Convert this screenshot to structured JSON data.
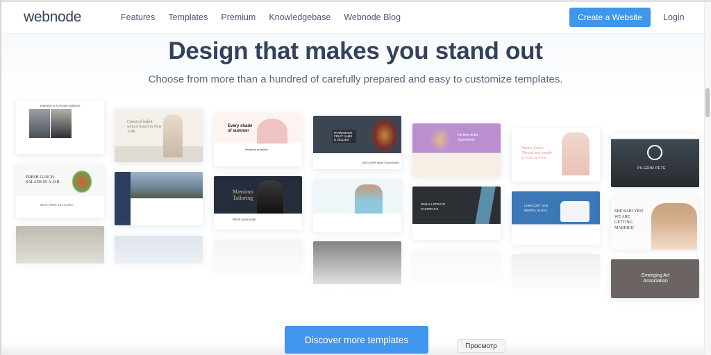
{
  "nav": {
    "logo": "webnode",
    "links": [
      "Features",
      "Templates",
      "Premium",
      "Knowledgebase",
      "Webnode Blog"
    ],
    "cta": "Create a Website",
    "login": "Login"
  },
  "hero": {
    "title": "Design that makes you stand out",
    "subtitle": "Choose from more than a hundred of carefully prepared and easy to customize templates."
  },
  "templates": [
    {
      "headline": "FRIENDS vs AUTUMN STREETS"
    },
    {
      "headline": "FRESH LUNCH SALADS IN A JAR"
    },
    {
      "headline": "Classical ballet school based in New York"
    },
    {
      "headline": "Every shade of summer"
    },
    {
      "headline": "Featured products"
    },
    {
      "headline": "Massimo Tailoring"
    },
    {
      "headline": "We're passionate"
    },
    {
      "headline": "HOMEMADE FRUIT JAMS & JELLIES"
    },
    {
      "headline": "DISCOVER NEW FLAVOURS"
    },
    {
      "headline": "It's time to be Superhero!"
    },
    {
      "headline": "ONELLI STRATO FASTER 8.8"
    },
    {
      "headline": "Emma Jones: Thread and needle at your service"
    },
    {
      "headline": "LOW-COST VAN RENTAL IN NYC"
    },
    {
      "headline": "PILGRIM PETE"
    },
    {
      "headline": "SHE SAID YES! WE ARE GETTING MARRIED"
    },
    {
      "headline": "Emerging Art Association"
    },
    {
      "headline": "MOST POPULAR SALADS"
    }
  ],
  "discover_button": "Discover more templates",
  "tooltip": "Просмотр",
  "colors": {
    "accent": "#4095ec",
    "heading": "#33415c"
  }
}
